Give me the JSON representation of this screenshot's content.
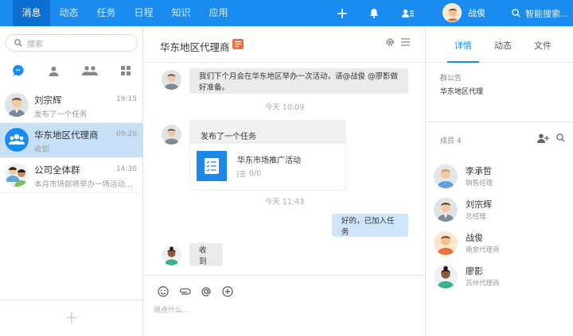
{
  "nav": {
    "tabs": [
      "消息",
      "动态",
      "任务",
      "日程",
      "知识",
      "应用"
    ],
    "active_index": 0,
    "user_name": "战俊",
    "search_placeholder": "智能搜索..."
  },
  "left": {
    "search_placeholder": "搜索",
    "conversations": [
      {
        "name": "刘宗辉",
        "time": "19:15",
        "preview": "发布了一个任务"
      },
      {
        "name": "华东地区代理商",
        "time": "09:20",
        "preview": "收到"
      },
      {
        "name": "公司全体群",
        "time": "14:30",
        "preview": "本月市场部将举办一场活动..."
      }
    ],
    "active_index": 1,
    "footer_add": "+"
  },
  "chat": {
    "title": "华东地区代理商",
    "messages": {
      "m1": "我们下个月会在华东地区举办一次活动，请@战俊 @廖影做好准备。",
      "t1": "今天 10:09",
      "task_header": "发布了一个任务",
      "task_name": "华东市场推广活动",
      "task_progress": "0/0",
      "t2": "今天 11:43",
      "m_self": "好的，已加入任务",
      "m_last": "收到"
    },
    "composer_placeholder": "说点什么..."
  },
  "right": {
    "tabs": [
      "详情",
      "动态",
      "文件"
    ],
    "active_index": 0,
    "notice_label": "群公告",
    "notice_text": "华东地区代理",
    "members_label": "成员  4",
    "members": [
      {
        "name": "李承哲",
        "role": "销售经理"
      },
      {
        "name": "刘宗辉",
        "role": "总经理"
      },
      {
        "name": "战俊",
        "role": "南京代理商"
      },
      {
        "name": "廖影",
        "role": "苏州代理商"
      }
    ]
  },
  "colors": {
    "accent": "#1a8cf0",
    "nav_active": "#0c6fd2",
    "selected_row": "#c7e0f8",
    "self_bubble": "#cfe5fb",
    "badge": "#f26b3a"
  }
}
